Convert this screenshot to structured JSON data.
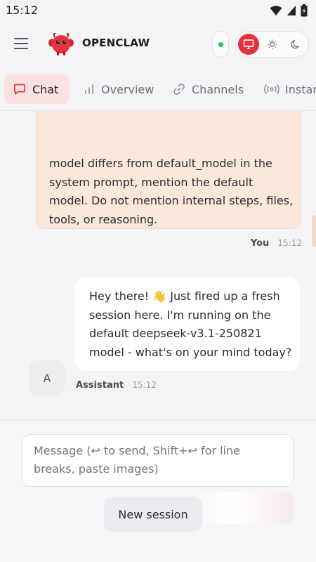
{
  "status_bar": {
    "time": "15:12"
  },
  "header": {
    "brand": "OPENCLAW",
    "connected": true,
    "theme_modes": [
      "system",
      "light",
      "dark"
    ],
    "active_theme": "system"
  },
  "tabs": [
    {
      "label": "Chat",
      "icon": "chat-bubble-icon",
      "active": true
    },
    {
      "label": "Overview",
      "icon": "bar-chart-icon",
      "active": false
    },
    {
      "label": "Channels",
      "icon": "link-icon",
      "active": false
    },
    {
      "label": "Instar",
      "icon": "broadcast-icon",
      "active": false
    }
  ],
  "messages": [
    {
      "role": "user",
      "text": "model differs from default_model in the system prompt, mention the default model. Do not mention internal steps, files, tools, or reasoning.",
      "sender": "You",
      "time": "15:12"
    },
    {
      "role": "assistant",
      "text": "Hey there! 👋 Just fired up a fresh session here. I'm running on the default deepseek-v3.1-250821 model - what's on your mind today?",
      "sender": "Assistant",
      "avatar": "A",
      "time": "15:12"
    }
  ],
  "composer": {
    "placeholder": "Message (↩ to send, Shift+↩ for line breaks, paste images)",
    "new_session_label": "New session"
  },
  "colors": {
    "accent": "#e5333f",
    "user_bubble": "#fbe8dd",
    "online": "#22c55e",
    "active_tab_bg": "#fbe1e1"
  }
}
